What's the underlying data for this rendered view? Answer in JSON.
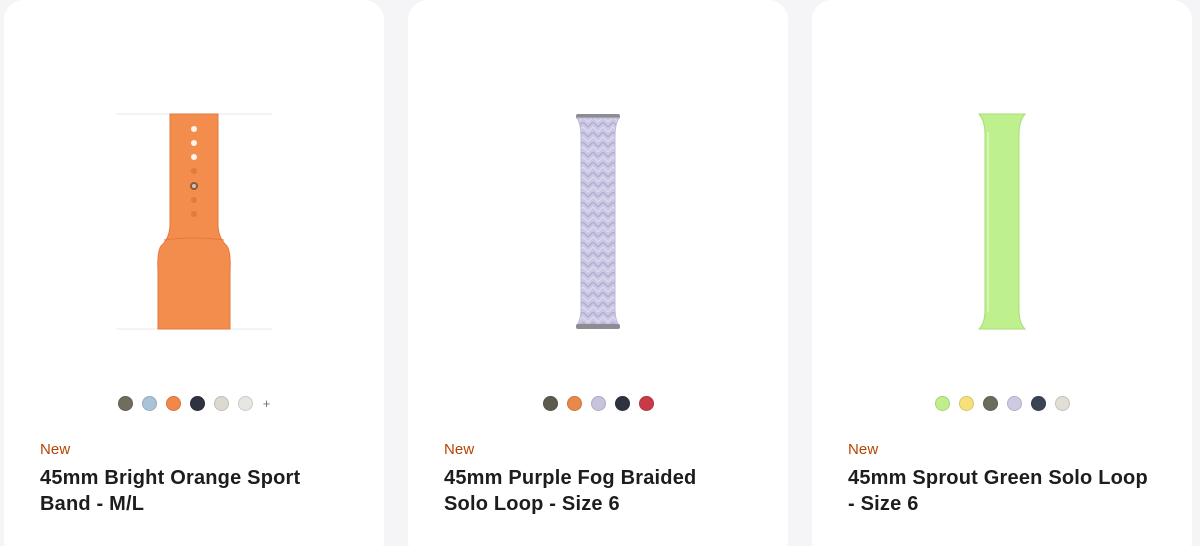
{
  "products": [
    {
      "badge": "New",
      "title": "45mm Bright Orange Sport Band - M/L",
      "image": "orange-sport-band-image",
      "band_color": "#f38d4e",
      "swatches": [
        "#6f6d5e",
        "#a9c3d8",
        "#f2874a",
        "#2f3340",
        "#dcd9d1",
        "#e6e6e2"
      ],
      "more_label": "+"
    },
    {
      "badge": "New",
      "title": "45mm Purple Fog Braided Solo Loop - Size 6",
      "image": "purple-braided-solo-loop-image",
      "band_color": "#c9c6e2",
      "swatches": [
        "#5d5b4e",
        "#e8884a",
        "#c6c3dd",
        "#2f3340",
        "#c93a48"
      ]
    },
    {
      "badge": "New",
      "title": "45mm Sprout Green Solo Loop - Size 6",
      "image": "green-solo-loop-image",
      "band_color": "#bff08e",
      "swatches": [
        "#bfee8b",
        "#f6e07a",
        "#6b6c5c",
        "#cfc9e3",
        "#3a4452",
        "#e2ded6"
      ]
    }
  ]
}
